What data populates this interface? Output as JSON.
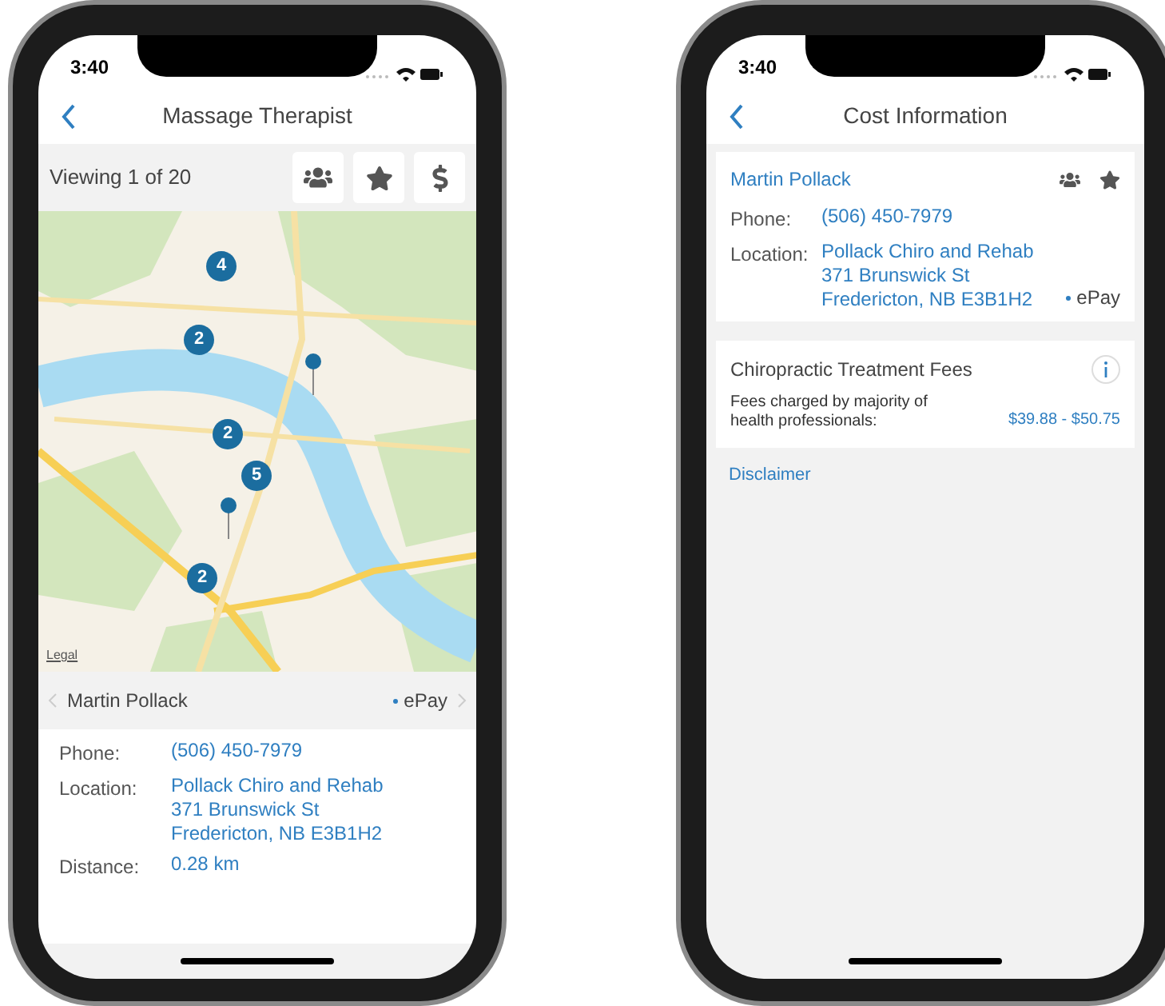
{
  "left_phone": {
    "status_bar": {
      "time": "3:40"
    },
    "nav": {
      "title": "Massage Therapist"
    },
    "toolbar": {
      "viewing": "Viewing 1 of 20",
      "buttons": [
        {
          "kind": "group"
        },
        {
          "kind": "star"
        },
        {
          "kind": "dollar"
        }
      ]
    },
    "map": {
      "clusters": [
        {
          "count": "4"
        },
        {
          "count": "2"
        },
        {
          "count": "2"
        },
        {
          "count": "5"
        },
        {
          "count": "2"
        }
      ],
      "pins": [
        {
          "kind": "pin"
        },
        {
          "kind": "pin"
        }
      ],
      "legal": "Legal"
    },
    "provider_bar": {
      "name": "Martin Pollack",
      "badge": "ePay"
    },
    "details": [
      {
        "label": "Phone:",
        "lines": [
          "(506) 450-7979"
        ]
      },
      {
        "label": "Location:",
        "lines": [
          "Pollack Chiro and Rehab",
          "371 Brunswick St",
          "Fredericton, NB E3B1H2"
        ]
      },
      {
        "label": "Distance:",
        "lines": [
          "0.28 km"
        ]
      }
    ]
  },
  "right_phone": {
    "status_bar": {
      "time": "3:40"
    },
    "nav": {
      "title": "Cost Information"
    },
    "provider_card": {
      "name": "Martin Pollack",
      "icons": [
        {
          "kind": "group"
        },
        {
          "kind": "star"
        }
      ],
      "details": [
        {
          "label": "Phone:",
          "lines": [
            "(506) 450-7979"
          ]
        },
        {
          "label": "Location:",
          "lines": [
            "Pollack Chiro and Rehab",
            "371 Brunswick St",
            "Fredericton, NB E3B1H2"
          ]
        }
      ],
      "badge": "ePay"
    },
    "fees_card": {
      "title": "Chiropractic Treatment Fees",
      "description": "Fees charged by majority of health professionals:",
      "range": "$39.88 - $50.75"
    },
    "disclaimer": "Disclaimer"
  }
}
